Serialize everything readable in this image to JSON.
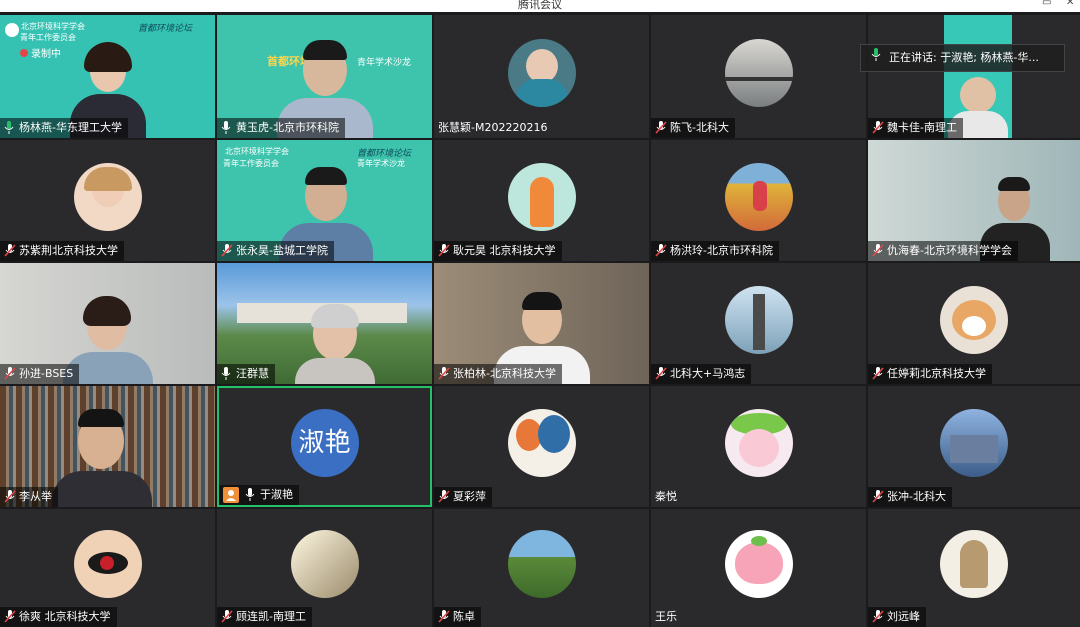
{
  "window": {
    "title": "腾讯会议"
  },
  "speaking_indicator": {
    "label": "正在讲话: 于淑艳; 杨林燕-华..."
  },
  "banners": {
    "org": "北京环境科学学会",
    "sub1": "青年工作委员会",
    "sub2": "青年学术沙龙",
    "capital": "首都环境论坛",
    "recording": "录制中"
  },
  "participants": [
    {
      "name": "杨林燕-华东理工大学",
      "mic": "on"
    },
    {
      "name": "黄玉虎-北京市环科院",
      "mic": "on"
    },
    {
      "name": "张慧颖-M202220216",
      "mic": "none"
    },
    {
      "name": "陈飞-北科大",
      "mic": "muted"
    },
    {
      "name": "魏卡佳-南理工",
      "mic": "muted"
    },
    {
      "name": "苏紫荆北京科技大学",
      "mic": "muted"
    },
    {
      "name": "张永昊-盐城工学院",
      "mic": "muted"
    },
    {
      "name": "耿元昊 北京科技大学",
      "mic": "muted"
    },
    {
      "name": "杨洪玲-北京市环科院",
      "mic": "muted"
    },
    {
      "name": "仇海春-北京环境科学学会",
      "mic": "muted"
    },
    {
      "name": "孙进-BSES",
      "mic": "muted"
    },
    {
      "name": "汪群慧",
      "mic": "on"
    },
    {
      "name": "张柏林-北京科技大学",
      "mic": "muted"
    },
    {
      "name": "北科大+马鸿志",
      "mic": "muted"
    },
    {
      "name": "任婷莉北京科技大学",
      "mic": "muted"
    },
    {
      "name": "李从举",
      "mic": "muted"
    },
    {
      "name": "于淑艳",
      "mic": "on",
      "avatar_text": "淑艳"
    },
    {
      "name": "夏彩萍",
      "mic": "muted"
    },
    {
      "name": "秦悦",
      "mic": "none"
    },
    {
      "name": "张冲-北科大",
      "mic": "muted"
    },
    {
      "name": "徐爽 北京科技大学",
      "mic": "muted"
    },
    {
      "name": "顾连凯-南理工",
      "mic": "muted"
    },
    {
      "name": "陈卓",
      "mic": "muted"
    },
    {
      "name": "王乐",
      "mic": "none"
    },
    {
      "name": "刘远峰",
      "mic": "muted"
    }
  ],
  "colors": {
    "active_border": "#27c06a",
    "avatar_blue": "#3a6fc4",
    "muted_red": "#e04848",
    "banner_teal": "#2fb7a8"
  }
}
